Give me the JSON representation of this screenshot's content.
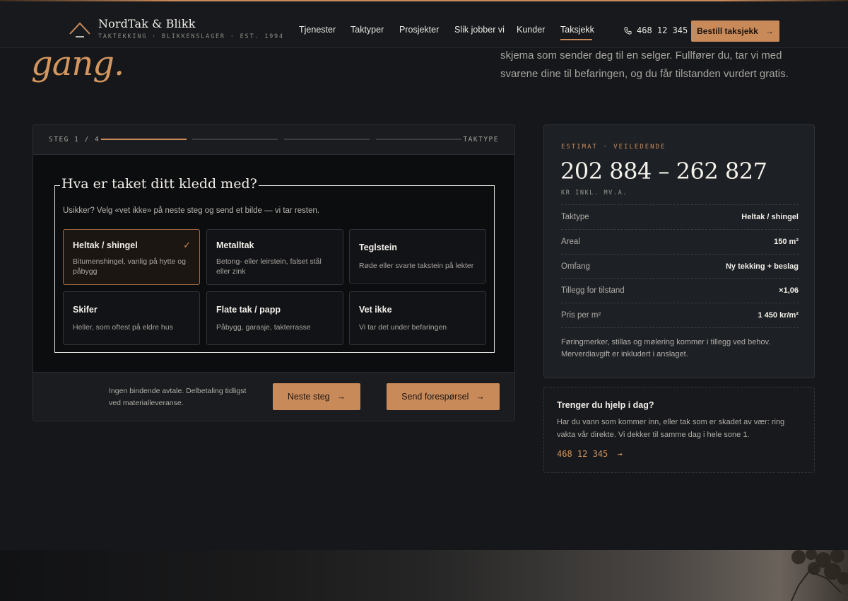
{
  "header": {
    "brand_name": "NordTak & Blikk",
    "brand_tagline": "TAKTEKKING · BLIKKENSLAGER · EST. 1994",
    "nav": [
      {
        "label": "Tjenester",
        "active": false
      },
      {
        "label": "Taktyper",
        "active": false
      },
      {
        "label": "Prosjekter",
        "active": false
      },
      {
        "label": "Slik jobber vi",
        "active": false
      },
      {
        "label": "Kunder",
        "active": false
      },
      {
        "label": "Taksjekk",
        "active": true
      }
    ],
    "phone": "468 12 345",
    "cta_label": "Bestill taksjekk",
    "cta_arrow": "→"
  },
  "hero": {
    "word": "gang.",
    "text": "skjema som sender deg til en selger. Fullfører du, tar vi med svarene dine til befaringen, og du får tilstanden vurdert gratis."
  },
  "wizard": {
    "step_label": "STEG 1 / 4",
    "step_current": 1,
    "step_total": 4,
    "step_name": "TAKTYPE",
    "question": "Hva er taket ditt kledd med?",
    "hint": "Usikker? Velg «vet ikke» på neste steg og send et bilde — vi tar resten.",
    "options": [
      {
        "title": "Heltak / shingel",
        "desc": "Bitumenshingel, vanlig på hytte og påbygg",
        "selected": true,
        "check": "✓"
      },
      {
        "title": "Metalltak",
        "desc": "Betong- eller leirstein, falset stål eller zink",
        "selected": false
      },
      {
        "title": "Teglstein",
        "desc": "Røde eller svarte takstein på lekter",
        "selected": false
      },
      {
        "title": "Skifer",
        "desc": "Heller, som oftest på eldre hus",
        "selected": false
      },
      {
        "title": "Flate tak / papp",
        "desc": "Påbygg, garasje, takterrasse",
        "selected": false
      },
      {
        "title": "Vet ikke",
        "desc": "Vi tar det under befaringen",
        "selected": false
      }
    ],
    "footer_note": "Ingen bindende avtale. Delbetaling tidligst ved materialleveranse.",
    "next_label": "Neste steg",
    "send_label": "Send forespørsel",
    "arrow": "→"
  },
  "estimate": {
    "kicker": "ESTIMAT · VEILEDENDE",
    "value": "202 884 – 262 827",
    "unit": "KR INKL. MV.A.",
    "rows": [
      {
        "key": "Taktype",
        "value": "Heltak / shingel"
      },
      {
        "key": "Areal",
        "value": "150 m²"
      },
      {
        "key": "Omfang",
        "value": "Ny tekking + beslag"
      },
      {
        "key": "Tillegg for tilstand",
        "value": "×1,06"
      },
      {
        "key": "Pris per m²",
        "value": "1 450 kr/m²"
      }
    ],
    "note": "Føringmerker, stillas og mølering kommer i tillegg ved behov. Merverdiavgift er inkludert i anslaget."
  },
  "help": {
    "title": "Trenger du hjelp i dag?",
    "text": "Har du vann som kommer inn, eller tak som er skadet av vær: ring vakta vår direkte. Vi dekker til samme dag i hele sone 1.",
    "link": "468 12 345",
    "arrow": "→"
  },
  "colors": {
    "accent": "#c98a5a",
    "background": "#15171a",
    "panel": "#1d2024"
  }
}
